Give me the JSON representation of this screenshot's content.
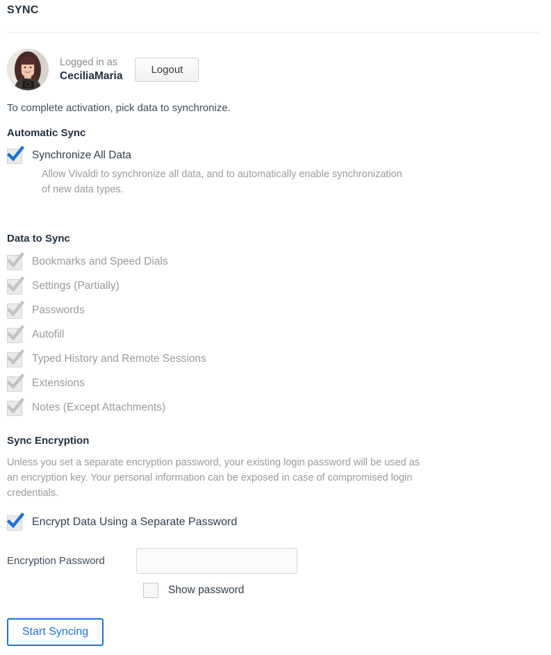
{
  "page": {
    "title": "SYNC"
  },
  "account": {
    "logged_in_label": "Logged in as",
    "username": "CeciliaMaria",
    "logout_label": "Logout",
    "avatar_name": "user-avatar"
  },
  "activation_note": "To complete activation, pick data to synchronize.",
  "automatic_sync": {
    "heading": "Automatic Sync",
    "checkbox_label": "Synchronize All Data",
    "checkbox_checked": true,
    "description": "Allow Vivaldi to synchronize all data, and to automatically enable synchronization of new data types."
  },
  "data_to_sync": {
    "heading": "Data to Sync",
    "items": [
      {
        "label": "Bookmarks and Speed Dials",
        "checked": true,
        "disabled": true
      },
      {
        "label": "Settings (Partially)",
        "checked": true,
        "disabled": true
      },
      {
        "label": "Passwords",
        "checked": true,
        "disabled": true
      },
      {
        "label": "Autofill",
        "checked": true,
        "disabled": true
      },
      {
        "label": "Typed History and Remote Sessions",
        "checked": true,
        "disabled": true
      },
      {
        "label": "Extensions",
        "checked": true,
        "disabled": true
      },
      {
        "label": "Notes (Except Attachments)",
        "checked": true,
        "disabled": true
      }
    ]
  },
  "sync_encryption": {
    "heading": "Sync Encryption",
    "description": "Unless you set a separate encryption password, your existing login password will be used as an encryption key. Your personal information can be exposed in case of compromised login credentials.",
    "encrypt_checkbox_label": "Encrypt Data Using a Separate Password",
    "encrypt_checkbox_checked": true,
    "password_label": "Encryption Password",
    "password_value": "",
    "password_placeholder": "",
    "show_password_label": "Show password",
    "show_password_checked": false
  },
  "actions": {
    "start_syncing_label": "Start Syncing"
  },
  "colors": {
    "accent_blue": "#1a73d6",
    "heading": "#22303f",
    "muted": "#9a9a9a",
    "divider": "#e6e8ea"
  }
}
